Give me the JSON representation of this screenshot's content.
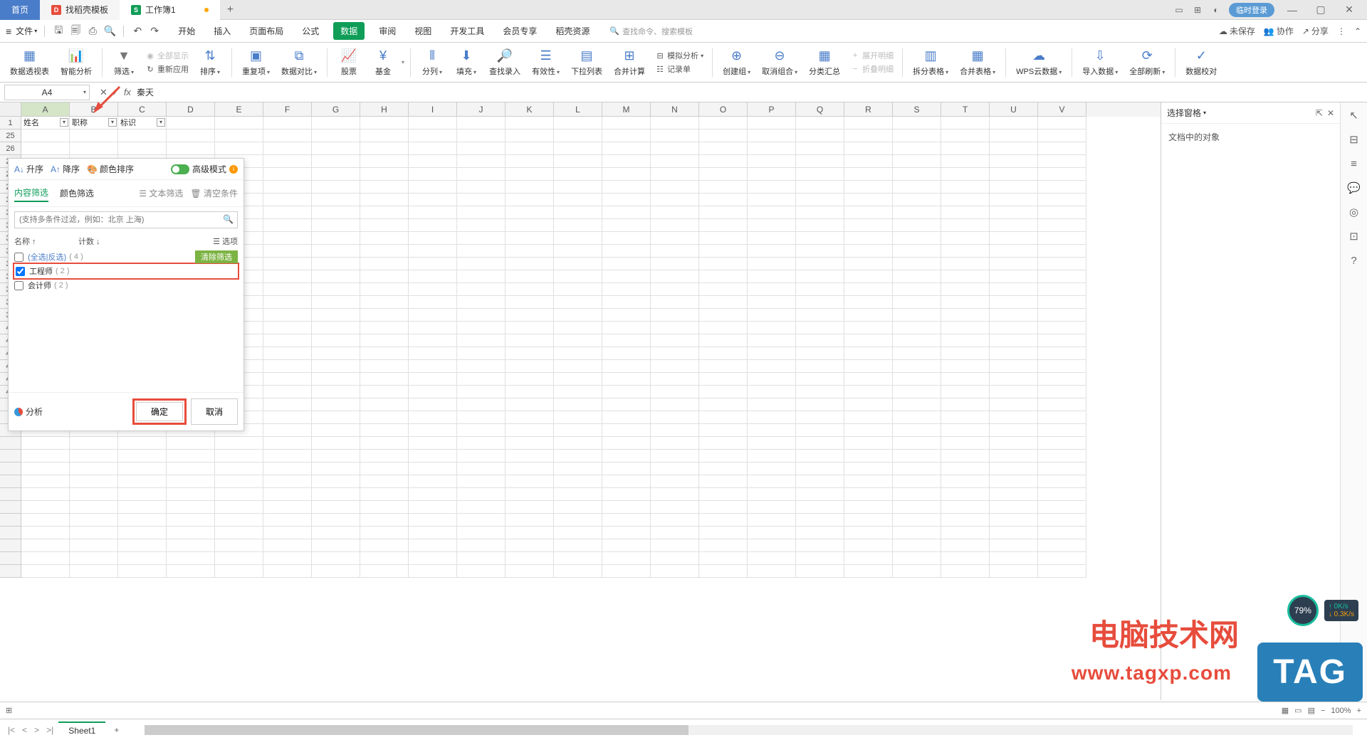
{
  "titlebar": {
    "home": "首页",
    "template": "找稻壳模板",
    "workbook": "工作簿1",
    "add": "+",
    "login": "临时登录"
  },
  "menubar": {
    "file": "文件",
    "tabs": [
      "开始",
      "插入",
      "页面布局",
      "公式",
      "数据",
      "审阅",
      "视图",
      "开发工具",
      "会员专享",
      "稻壳资源"
    ],
    "active_index": 4,
    "search_placeholder": "查找命令、搜索模板",
    "unsaved": "未保存",
    "collab": "协作",
    "share": "分享"
  },
  "ribbon": {
    "pivot": "数据透视表",
    "smart_analysis": "智能分析",
    "filter": "筛选",
    "show_all": "全部显示",
    "reapply": "重新应用",
    "sort": "排序",
    "duplicate": "重复项",
    "data_compare": "数据对比",
    "stock": "股票",
    "fund": "基金",
    "text_to_cols": "分列",
    "fill": "填充",
    "find_input": "查找录入",
    "validation": "有效性",
    "dropdown_list": "下拉列表",
    "consolidate": "合并计算",
    "simulate": "模拟分析",
    "record_form": "记录单",
    "create_group": "创建组",
    "ungroup": "取消组合",
    "subtotal": "分类汇总",
    "expand_detail": "展开明细",
    "collapse_detail": "折叠明细",
    "split_table": "拆分表格",
    "merge_table": "合并表格",
    "wps_cloud": "WPS云数据",
    "import_data": "导入数据",
    "refresh_all": "全部刷新",
    "data_check": "数据校对"
  },
  "formula": {
    "name": "A4",
    "fx": "fx",
    "value": "秦天"
  },
  "columns": [
    "A",
    "B",
    "C",
    "D",
    "E",
    "F",
    "G",
    "H",
    "I",
    "J",
    "K",
    "L",
    "M",
    "N",
    "O",
    "P",
    "Q",
    "R",
    "S",
    "T",
    "U",
    "V"
  ],
  "headers": {
    "a": "姓名",
    "b": "职称",
    "c": "标识"
  },
  "visible_rows": [
    1,
    25,
    26,
    27,
    28,
    29,
    30,
    31,
    32,
    33,
    34,
    35,
    36,
    37,
    38,
    39,
    40,
    41,
    42,
    43,
    44,
    45
  ],
  "filter_panel": {
    "asc": "升序",
    "desc": "降序",
    "color_sort": "颜色排序",
    "advanced": "高级模式",
    "tab_content": "内容筛选",
    "tab_color": "颜色筛选",
    "text_filter": "文本筛选",
    "clear_cond": "清空条件",
    "search_placeholder": "(支持多条件过滤，例如：北京 上海)",
    "col_name": "名称",
    "col_count": "计数",
    "options": "选项",
    "select_all": "(全选|反选)",
    "select_all_count": "( 4 )",
    "clear_filter": "清除筛选",
    "items": [
      {
        "label": "工程师",
        "count": "( 2 )",
        "checked": true,
        "highlighted": true
      },
      {
        "label": "会计师",
        "count": "( 2 )",
        "checked": false,
        "highlighted": false
      }
    ],
    "analyze": "分析",
    "ok": "确定",
    "cancel": "取消"
  },
  "right_pane": {
    "title": "选择窗格",
    "body": "文档中的对象"
  },
  "sheet": {
    "name": "Sheet1"
  },
  "status": {
    "zoom": "100%"
  },
  "watermark": {
    "line1": "电脑技术网",
    "line2": "www.tagxp.com",
    "badge": "TAG"
  },
  "speed": {
    "percent": "79%",
    "up": "0K/s",
    "down": "0.3K/s"
  }
}
